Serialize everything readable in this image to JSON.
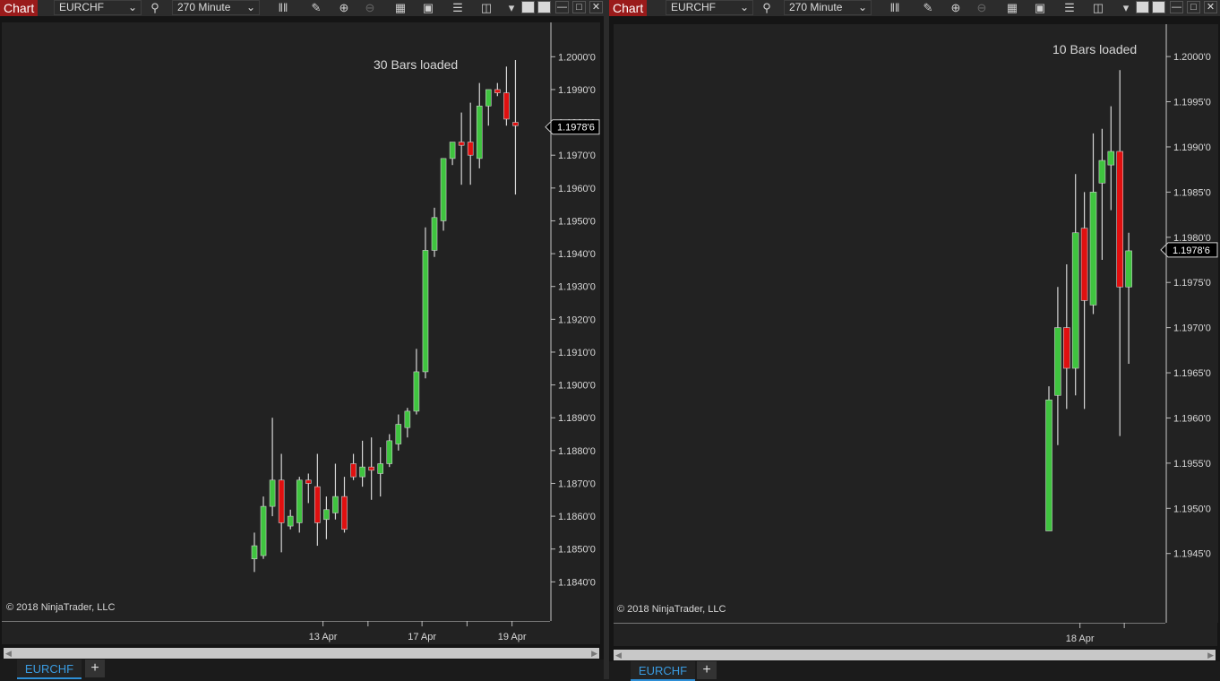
{
  "colors": {
    "up": "#3fc43f",
    "down": "#e01010",
    "wick": "#d6d6d6",
    "background": "#222222",
    "chart_tab": "#9a1b1b",
    "symbol_tab": "#3a9be0"
  },
  "left_window": {
    "chart_tab_label": "Chart",
    "instrument": "EURCHF",
    "interval": "270 Minute",
    "bars_loaded": "30 Bars loaded",
    "copyright": "© 2018 NinjaTrader, LLC",
    "current_price": "1.1978'6",
    "symbol_tab": "EURCHF",
    "add_tab": "+"
  },
  "right_window": {
    "chart_tab_label": "Chart",
    "instrument": "EURCHF",
    "interval": "270 Minute",
    "bars_loaded": "10 Bars loaded",
    "copyright": "© 2018 NinjaTrader, LLC",
    "current_price": "1.1978'6",
    "symbol_tab": "EURCHF",
    "add_tab": "+"
  },
  "toolbar_icons": [
    "search-icon",
    "bar-type-icon",
    "draw-pencil-icon",
    "zoom-in-icon",
    "zoom-out-icon",
    "grid-icon",
    "data-box-icon",
    "properties-icon",
    "strategies-icon",
    "dropdown-icon"
  ],
  "chart_data": [
    {
      "type": "candlestick",
      "instrument": "EURCHF",
      "ylim": [
        1.1836,
        1.2002
      ],
      "yticks": [
        1.184,
        1.185,
        1.186,
        1.187,
        1.188,
        1.189,
        1.19,
        1.191,
        1.192,
        1.193,
        1.194,
        1.195,
        1.196,
        1.197,
        1.198,
        1.199,
        1.2
      ],
      "ytick_labels": [
        "1.1840'0",
        "1.1850'0",
        "1.1860'0",
        "1.1870'0",
        "1.1880'0",
        "1.1890'0",
        "1.1900'0",
        "1.1910'0",
        "1.1920'0",
        "1.1930'0",
        "1.1940'0",
        "1.1950'0",
        "1.1960'0",
        "1.1970'0",
        "1.1980'0",
        "1.1990'0",
        "1.2000'0"
      ],
      "xtick_labels": [
        {
          "bar": 7.5,
          "label": "13 Apr"
        },
        {
          "bar": 18.5,
          "label": "17 Apr"
        },
        {
          "bar": 28.5,
          "label": "19 Apr"
        }
      ],
      "x_minor_ticks": [
        12.5,
        23.5
      ],
      "last_price": 1.19786,
      "series": [
        {
          "o": 1.1847,
          "h": 1.1855,
          "l": 1.1843,
          "c": 1.1851
        },
        {
          "o": 1.1848,
          "h": 1.1866,
          "l": 1.1847,
          "c": 1.1863
        },
        {
          "o": 1.1863,
          "h": 1.189,
          "l": 1.186,
          "c": 1.1871
        },
        {
          "o": 1.1871,
          "h": 1.1879,
          "l": 1.1849,
          "c": 1.1858
        },
        {
          "o": 1.1857,
          "h": 1.1862,
          "l": 1.1856,
          "c": 1.186
        },
        {
          "o": 1.1858,
          "h": 1.1872,
          "l": 1.1855,
          "c": 1.1871
        },
        {
          "o": 1.1871,
          "h": 1.1873,
          "l": 1.1864,
          "c": 1.187
        },
        {
          "o": 1.1869,
          "h": 1.1879,
          "l": 1.1851,
          "c": 1.1858
        },
        {
          "o": 1.1859,
          "h": 1.1866,
          "l": 1.1853,
          "c": 1.1862
        },
        {
          "o": 1.1861,
          "h": 1.1876,
          "l": 1.1859,
          "c": 1.1866
        },
        {
          "o": 1.1866,
          "h": 1.1872,
          "l": 1.1855,
          "c": 1.1856
        },
        {
          "o": 1.1876,
          "h": 1.1879,
          "l": 1.1871,
          "c": 1.1872
        },
        {
          "o": 1.1872,
          "h": 1.1883,
          "l": 1.1869,
          "c": 1.1875
        },
        {
          "o": 1.1875,
          "h": 1.1884,
          "l": 1.1865,
          "c": 1.1874
        },
        {
          "o": 1.1873,
          "h": 1.1881,
          "l": 1.1866,
          "c": 1.1876
        },
        {
          "o": 1.1876,
          "h": 1.1885,
          "l": 1.1875,
          "c": 1.1883
        },
        {
          "o": 1.1882,
          "h": 1.1891,
          "l": 1.188,
          "c": 1.1888
        },
        {
          "o": 1.1887,
          "h": 1.1893,
          "l": 1.1884,
          "c": 1.1892
        },
        {
          "o": 1.1892,
          "h": 1.1911,
          "l": 1.1891,
          "c": 1.1904
        },
        {
          "o": 1.1904,
          "h": 1.1948,
          "l": 1.1902,
          "c": 1.1941
        },
        {
          "o": 1.1941,
          "h": 1.1954,
          "l": 1.1939,
          "c": 1.1951
        },
        {
          "o": 1.195,
          "h": 1.1969,
          "l": 1.1947,
          "c": 1.1969
        },
        {
          "o": 1.1969,
          "h": 1.1974,
          "l": 1.1967,
          "c": 1.1974
        },
        {
          "o": 1.1974,
          "h": 1.1983,
          "l": 1.1961,
          "c": 1.1973
        },
        {
          "o": 1.1974,
          "h": 1.1986,
          "l": 1.1961,
          "c": 1.197
        },
        {
          "o": 1.1969,
          "h": 1.1992,
          "l": 1.1966,
          "c": 1.1985
        },
        {
          "o": 1.1985,
          "h": 1.199,
          "l": 1.1979,
          "c": 1.199
        },
        {
          "o": 1.199,
          "h": 1.1992,
          "l": 1.1988,
          "c": 1.1989
        },
        {
          "o": 1.1989,
          "h": 1.1997,
          "l": 1.1979,
          "c": 1.1981
        },
        {
          "o": 1.198,
          "h": 1.1999,
          "l": 1.1958,
          "c": 1.1979
        }
      ]
    },
    {
      "type": "candlestick",
      "instrument": "EURCHF",
      "ylim": [
        1.19415,
        1.20015
      ],
      "yticks": [
        1.1945,
        1.195,
        1.1955,
        1.196,
        1.1965,
        1.197,
        1.1975,
        1.198,
        1.1985,
        1.199,
        1.1995,
        1.2
      ],
      "ytick_labels": [
        "1.1945'0",
        "1.1950'0",
        "1.1955'0",
        "1.1960'0",
        "1.1965'0",
        "1.1970'0",
        "1.1975'0",
        "1.1980'0",
        "1.1985'0",
        "1.1990'0",
        "1.1995'0",
        "1.2000'0"
      ],
      "xtick_labels": [
        {
          "bar": 3.5,
          "label": "18 Apr"
        }
      ],
      "x_minor_ticks": [
        8.5
      ],
      "last_price": 1.19786,
      "series": [
        {
          "o": 1.19475,
          "h": 1.19635,
          "l": 1.19495,
          "c": 1.1962
        },
        {
          "o": 1.19625,
          "h": 1.19745,
          "l": 1.1957,
          "c": 1.197
        },
        {
          "o": 1.197,
          "h": 1.1977,
          "l": 1.1961,
          "c": 1.19655
        },
        {
          "o": 1.19655,
          "h": 1.1987,
          "l": 1.19625,
          "c": 1.19805
        },
        {
          "o": 1.1981,
          "h": 1.1985,
          "l": 1.1961,
          "c": 1.1973
        },
        {
          "o": 1.19725,
          "h": 1.19915,
          "l": 1.19715,
          "c": 1.1985
        },
        {
          "o": 1.1986,
          "h": 1.1992,
          "l": 1.19775,
          "c": 1.19885
        },
        {
          "o": 1.1988,
          "h": 1.19945,
          "l": 1.1983,
          "c": 1.19895
        },
        {
          "o": 1.19895,
          "h": 1.19985,
          "l": 1.1958,
          "c": 1.19745
        },
        {
          "o": 1.19745,
          "h": 1.19805,
          "l": 1.1966,
          "c": 1.19785
        }
      ]
    }
  ]
}
